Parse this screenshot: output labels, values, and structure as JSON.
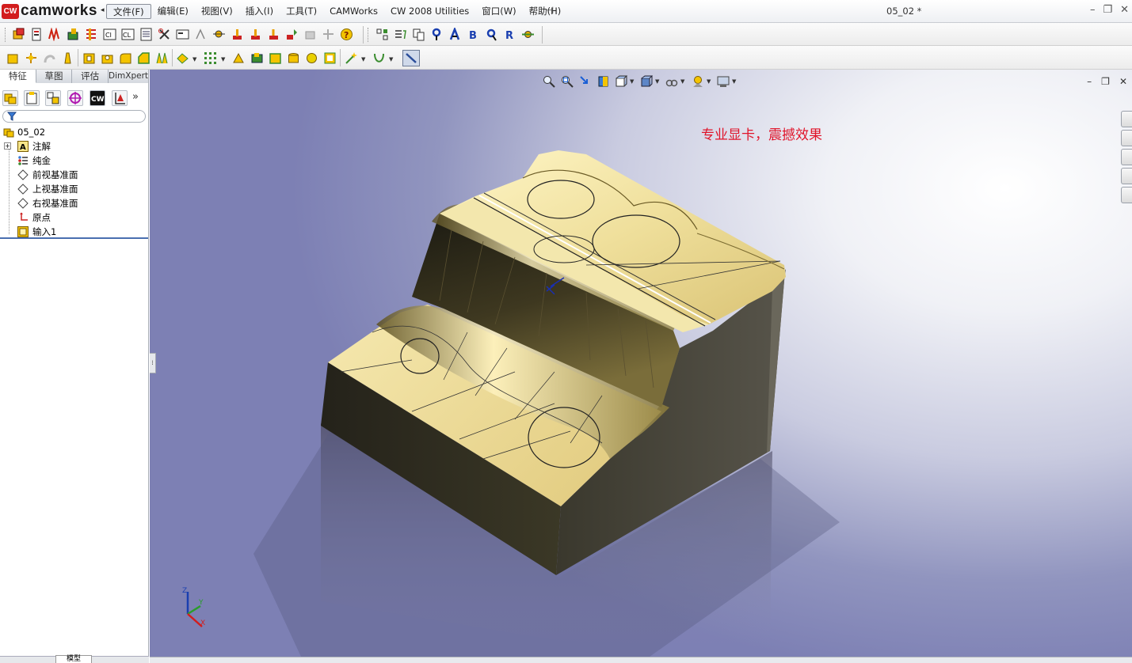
{
  "app": {
    "logo_badge": "CW",
    "logo_text": "camworks",
    "doc_title": "05_02 *"
  },
  "menu": {
    "items": [
      {
        "label": "文件(F)",
        "active": true
      },
      {
        "label": "编辑(E)"
      },
      {
        "label": "视图(V)"
      },
      {
        "label": "插入(I)"
      },
      {
        "label": "工具(T)"
      },
      {
        "label": "CAMWorks"
      },
      {
        "label": "CW 2008 Utilities"
      },
      {
        "label": "窗口(W)"
      },
      {
        "label": "帮助(H)"
      }
    ]
  },
  "panel": {
    "tabs": [
      {
        "label": "特征",
        "active": true
      },
      {
        "label": "草图"
      },
      {
        "label": "评估"
      },
      {
        "label": "DimXpert"
      }
    ],
    "tree": [
      {
        "label": "05_02",
        "icon": "part-icon"
      },
      {
        "label": "注解",
        "icon": "annotation-icon"
      },
      {
        "label": "纯金",
        "icon": "material-icon"
      },
      {
        "label": "前视基准面",
        "icon": "plane-icon"
      },
      {
        "label": "上视基准面",
        "icon": "plane-icon"
      },
      {
        "label": "右视基准面",
        "icon": "plane-icon"
      },
      {
        "label": "原点",
        "icon": "origin-icon"
      },
      {
        "label": "输入1",
        "icon": "imported-body-icon"
      }
    ],
    "bottom_tab": "模型"
  },
  "viewport": {
    "annotation": "专业显卡，震撼效果",
    "triad_labels": {
      "z": "Z",
      "y": "Y",
      "x": "X"
    }
  },
  "colors": {
    "annotation": "#e0142a",
    "gold_light": "#efe3a6",
    "gold_dark": "#3b351c",
    "side_face": "#2f2d25"
  }
}
